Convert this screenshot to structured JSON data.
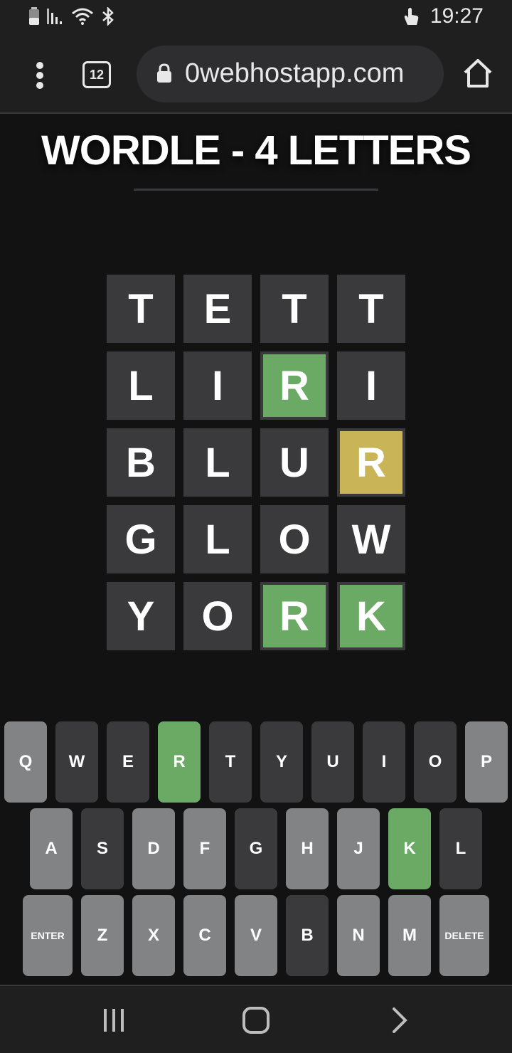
{
  "status_bar": {
    "time": "19:27",
    "icons": [
      "battery-icon",
      "signal-icon",
      "wifi-icon",
      "bluetooth-icon",
      "hand-icon"
    ]
  },
  "browser": {
    "tab_count": "12",
    "url": "0webhostapp.com",
    "icons": [
      "more-vert-icon",
      "lock-icon",
      "home-icon"
    ]
  },
  "game": {
    "title": "WORDLE - 4 LETTERS",
    "rows": [
      [
        {
          "letter": "T",
          "state": "absent"
        },
        {
          "letter": "E",
          "state": "absent"
        },
        {
          "letter": "T",
          "state": "absent"
        },
        {
          "letter": "T",
          "state": "absent"
        }
      ],
      [
        {
          "letter": "L",
          "state": "absent"
        },
        {
          "letter": "I",
          "state": "absent"
        },
        {
          "letter": "R",
          "state": "correct"
        },
        {
          "letter": "I",
          "state": "absent"
        }
      ],
      [
        {
          "letter": "B",
          "state": "absent"
        },
        {
          "letter": "L",
          "state": "absent"
        },
        {
          "letter": "U",
          "state": "absent"
        },
        {
          "letter": "R",
          "state": "present"
        }
      ],
      [
        {
          "letter": "G",
          "state": "absent"
        },
        {
          "letter": "L",
          "state": "absent"
        },
        {
          "letter": "O",
          "state": "absent"
        },
        {
          "letter": "W",
          "state": "absent"
        }
      ],
      [
        {
          "letter": "Y",
          "state": "absent"
        },
        {
          "letter": "O",
          "state": "absent"
        },
        {
          "letter": "R",
          "state": "correct"
        },
        {
          "letter": "K",
          "state": "correct"
        }
      ]
    ],
    "colors": {
      "correct": "#6aaa64",
      "present": "#c9b458",
      "absent": "#3a3a3c",
      "unused": "#818384"
    }
  },
  "keyboard": {
    "rows": [
      [
        {
          "label": "Q",
          "state": "unused"
        },
        {
          "label": "W",
          "state": "absent"
        },
        {
          "label": "E",
          "state": "absent"
        },
        {
          "label": "R",
          "state": "correct"
        },
        {
          "label": "T",
          "state": "absent"
        },
        {
          "label": "Y",
          "state": "absent"
        },
        {
          "label": "U",
          "state": "absent"
        },
        {
          "label": "I",
          "state": "absent"
        },
        {
          "label": "O",
          "state": "absent"
        },
        {
          "label": "P",
          "state": "unused"
        }
      ],
      [
        {
          "label": "A",
          "state": "unused"
        },
        {
          "label": "S",
          "state": "absent"
        },
        {
          "label": "D",
          "state": "unused"
        },
        {
          "label": "F",
          "state": "unused"
        },
        {
          "label": "G",
          "state": "absent"
        },
        {
          "label": "H",
          "state": "unused"
        },
        {
          "label": "J",
          "state": "unused"
        },
        {
          "label": "K",
          "state": "correct"
        },
        {
          "label": "L",
          "state": "absent"
        }
      ],
      [
        {
          "label": "ENTER",
          "state": "unused",
          "wide": true
        },
        {
          "label": "Z",
          "state": "unused"
        },
        {
          "label": "X",
          "state": "unused"
        },
        {
          "label": "C",
          "state": "unused"
        },
        {
          "label": "V",
          "state": "unused"
        },
        {
          "label": "B",
          "state": "absent"
        },
        {
          "label": "N",
          "state": "unused"
        },
        {
          "label": "M",
          "state": "unused"
        },
        {
          "label": "DELETE",
          "state": "unused",
          "wide": true
        }
      ]
    ]
  },
  "nav_bar": {
    "icons": [
      "recent-apps-icon",
      "home-circle-icon",
      "back-icon"
    ]
  }
}
